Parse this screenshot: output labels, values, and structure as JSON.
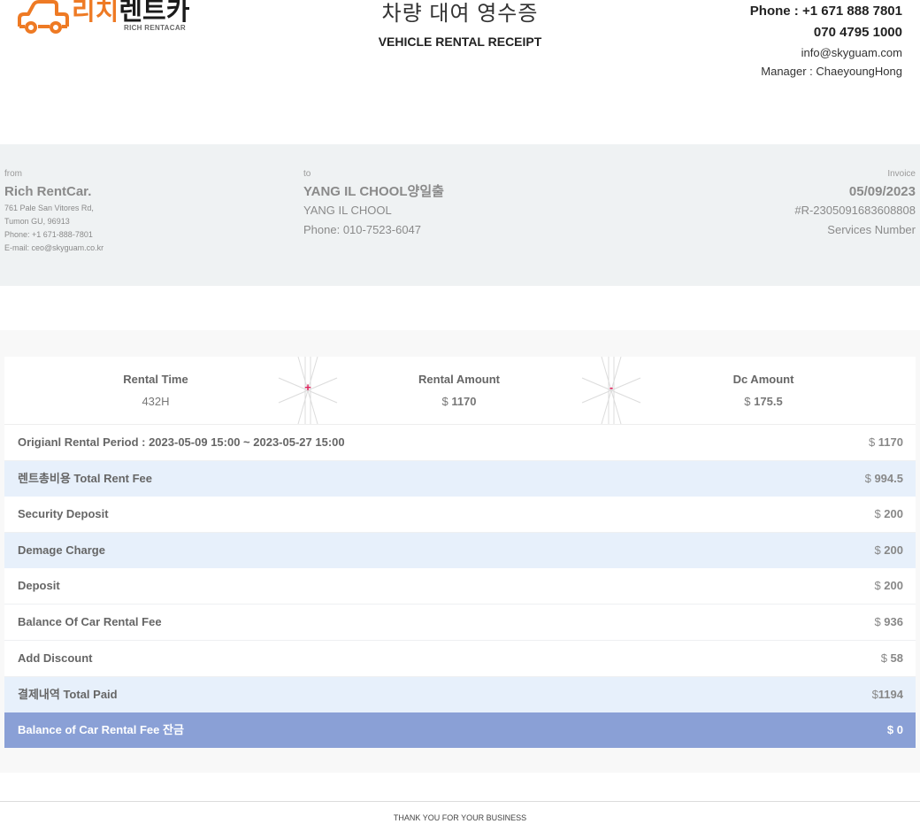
{
  "brand": {
    "logo_text_orange": "리치",
    "logo_text_dark": "렌트카",
    "logo_sub": "RICH RENTACAR",
    "accent": "#ee7a24"
  },
  "header": {
    "title_ko": "차량 대여 영수증",
    "title_en": "VEHICLE RENTAL RECEIPT"
  },
  "contact": {
    "phone1": "Phone : +1 671 888 7801",
    "phone2": "070 4795 1000",
    "email": "info@skyguam.com",
    "manager": "Manager : ChaeyoungHong"
  },
  "from": {
    "label": "from",
    "name": "Rich RentCar.",
    "address1": "761 Pale San Vitores Rd,",
    "address2": "Tumon GU, 96913",
    "phone": "Phone: +1 671-888-7801",
    "email": "E-mail: ceo@skyguam.co.kr"
  },
  "to": {
    "label": "to",
    "name": "YANG IL CHOOL양일출",
    "name2": "YANG IL CHOOL",
    "phone": "Phone: 010-7523-6047"
  },
  "invoice": {
    "label": "Invoice",
    "date": "05/09/2023",
    "number": "#R-2305091683608808",
    "number_label": "Services Number"
  },
  "summary": {
    "rental_time_label": "Rental Time",
    "rental_time_value": "432",
    "rental_time_unit": "H",
    "plus_sign": "+",
    "rental_amount_label": "Rental Amount",
    "rental_amount_currency": "$ ",
    "rental_amount_value": "1170",
    "minus_sign": "-",
    "dc_amount_label": "Dc Amount",
    "dc_amount_currency": "$ ",
    "dc_amount_value": "175.5"
  },
  "rows": [
    {
      "label": "Origianl Rental Period : 2023-05-09 15:00 ~ 2023-05-27 15:00",
      "currency": "$ ",
      "amount": "1170"
    },
    {
      "label": "렌트총비용 Total Rent Fee",
      "currency": "$ ",
      "amount": "994.5"
    },
    {
      "label": "Security Deposit",
      "currency": "$ ",
      "amount": "200"
    },
    {
      "label": "Demage Charge",
      "currency": "$ ",
      "amount": "200"
    },
    {
      "label": "Deposit",
      "currency": "$ ",
      "amount": "200"
    },
    {
      "label": "Balance Of Car Rental Fee",
      "currency": "$ ",
      "amount": "936"
    },
    {
      "label": "Add Discount",
      "currency": "$ ",
      "amount": "58"
    },
    {
      "label": "결제내역 Total Paid",
      "currency": "$",
      "amount": "1194"
    },
    {
      "label": "Balance of Car Rental Fee 잔금",
      "currency": "$ ",
      "amount": "0"
    }
  ],
  "footer": {
    "text": "THANK YOU FOR YOUR BUSINESS"
  }
}
